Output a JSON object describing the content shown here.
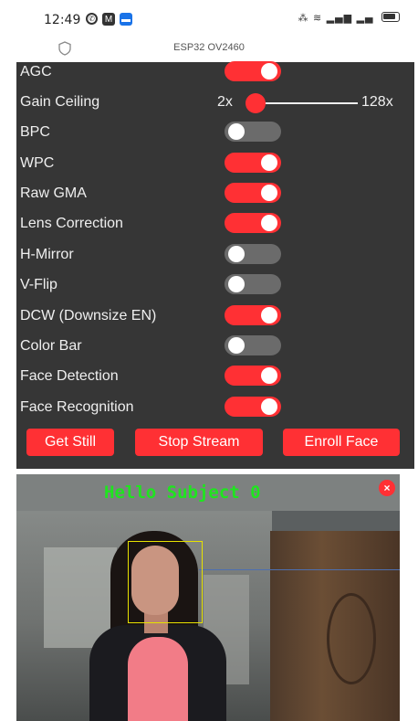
{
  "status_bar": {
    "time": "12:49",
    "right_text": "⁂ ᴴ⁺ ⁴ᴳ ▮▮▮ ▮▮ "
  },
  "browser": {
    "page_title": "ESP32 OV2460"
  },
  "controls": {
    "agc": {
      "label": "AGC",
      "on": true
    },
    "gain_ceiling": {
      "label": "Gain Ceiling",
      "min_label": "2x",
      "max_label": "128x",
      "value_fraction": 0.0
    },
    "bpc": {
      "label": "BPC",
      "on": false
    },
    "wpc": {
      "label": "WPC",
      "on": true
    },
    "raw_gma": {
      "label": "Raw GMA",
      "on": true
    },
    "lens_correction": {
      "label": "Lens Correction",
      "on": true
    },
    "h_mirror": {
      "label": "H-Mirror",
      "on": false
    },
    "v_flip": {
      "label": "V-Flip",
      "on": false
    },
    "dcw": {
      "label": "DCW (Downsize EN)",
      "on": true
    },
    "color_bar": {
      "label": "Color Bar",
      "on": false
    },
    "face_detection": {
      "label": "Face Detection",
      "on": true
    },
    "face_recognition": {
      "label": "Face Recognition",
      "on": true
    }
  },
  "buttons": {
    "get_still": "Get Still",
    "stop_stream": "Stop Stream",
    "enroll_face": "Enroll Face"
  },
  "stream": {
    "overlay_text": "Hello Subject 0",
    "close_symbol": "×"
  },
  "colors": {
    "accent": "#ff3034",
    "panel_bg": "#363636",
    "toggle_off": "#6b6b6b",
    "overlay_text": "#1fe51f",
    "face_box": "#e7e200"
  }
}
